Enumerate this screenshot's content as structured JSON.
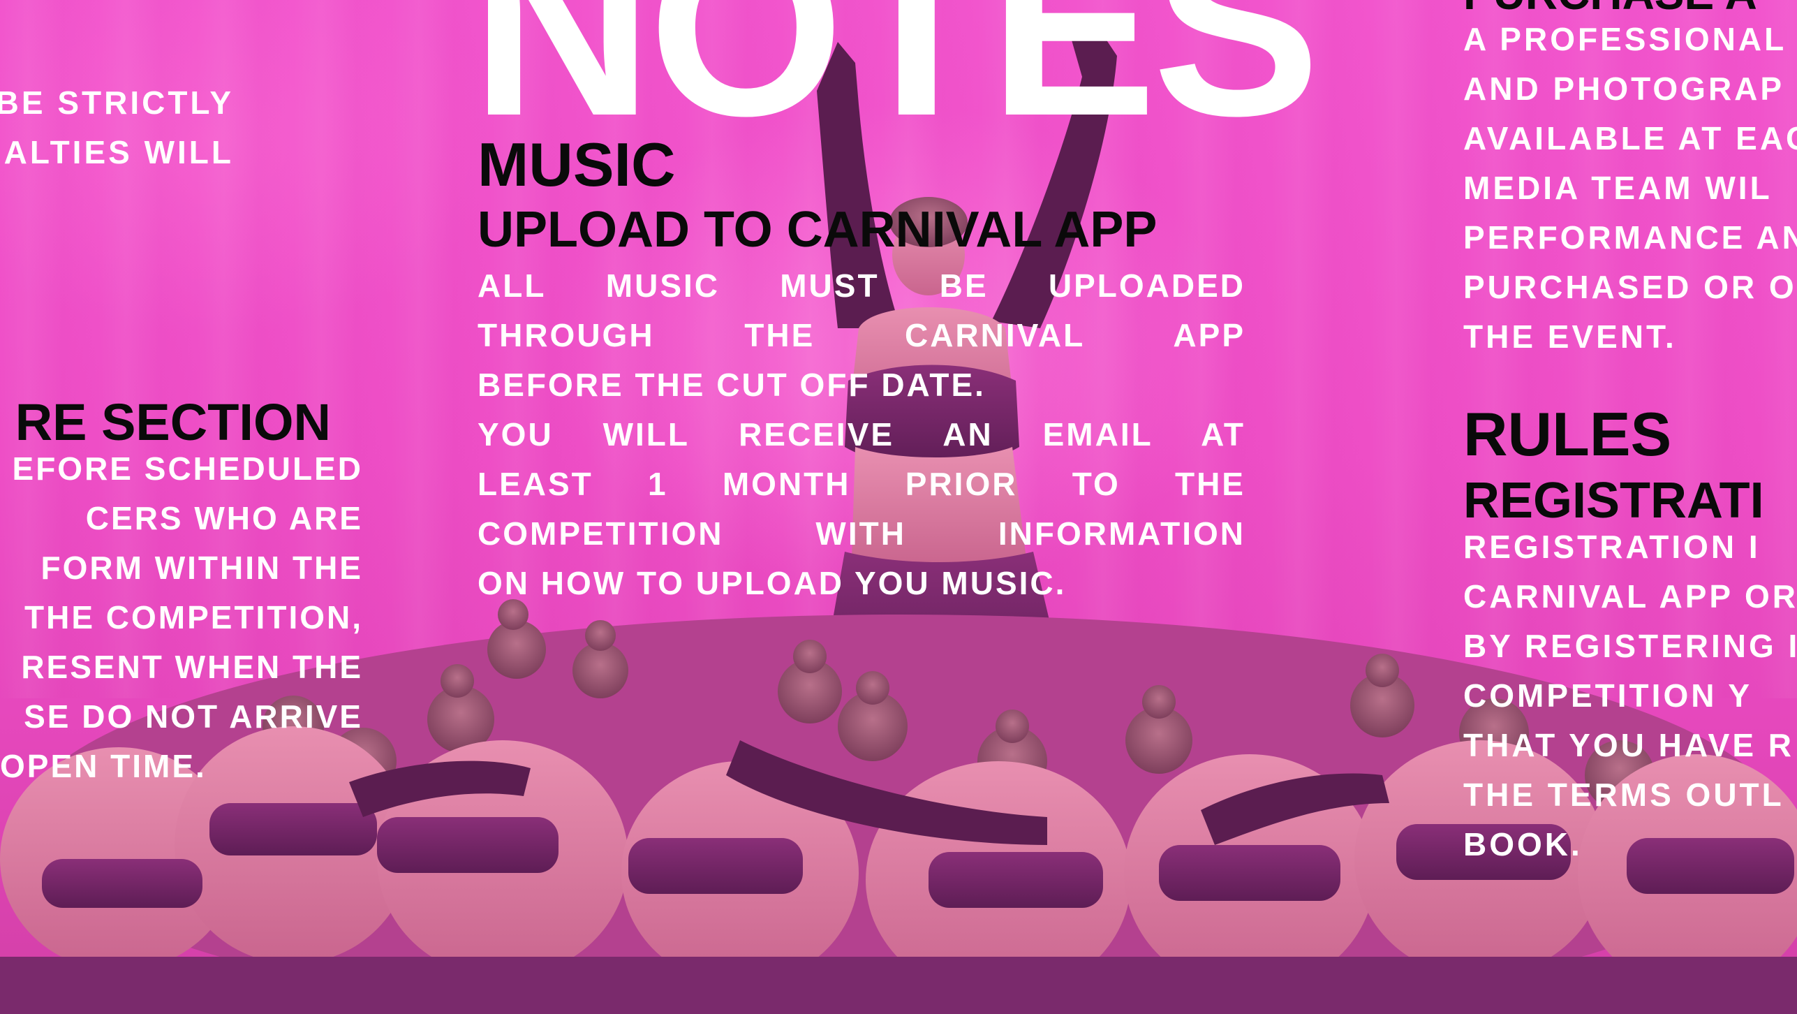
{
  "title": "NOTES",
  "left_column": {
    "intro_lines": [
      "BE STRICTLY",
      "NALTIES WILL"
    ],
    "heading": "RE SECTION",
    "body_lines": [
      "EFORE SCHEDULED",
      "CERS WHO ARE",
      "FORM WITHIN THE",
      "THE COMPETITION,",
      "RESENT WHEN THE",
      "SE DO NOT ARRIVE",
      "OPEN TIME."
    ]
  },
  "music": {
    "heading": "MUSIC",
    "subheading": "UPLOAD TO CARNIVAL APP",
    "body_lines": [
      "ALL MUSIC MUST BE UPLOADED",
      "THROUGH THE CARNIVAL APP",
      "BEFORE THE CUT OFF DATE.",
      "YOU WILL RECEIVE AN EMAIL AT",
      "LEAST 1 MONTH PRIOR TO THE",
      "COMPETITION WITH INFORMATION",
      "ON HOW TO UPLOAD YOU MUSIC."
    ]
  },
  "right_column": {
    "top_heading": "PURCHASE A",
    "top_body_lines": [
      "A PROFESSIONAL",
      "AND PHOTOGRAP",
      "AVAILABLE AT EAC",
      "MEDIA TEAM WIL",
      "PERFORMANCE AN",
      "PURCHASED OR O",
      "THE EVENT."
    ],
    "rules_heading": "RULES",
    "rules_subheading": "REGISTRATI",
    "rules_body_lines": [
      "REGISTRATION I",
      "CARNIVAL APP OR",
      "BY REGISTERING I",
      "COMPETITION Y",
      "THAT YOU HAVE R",
      "THE TERMS OUTL",
      "BOOK."
    ]
  },
  "colors": {
    "background": "#f04fc8",
    "heading_text": "#0a0a0a",
    "body_text": "#ffffff",
    "costume": "#7a2a6c"
  }
}
